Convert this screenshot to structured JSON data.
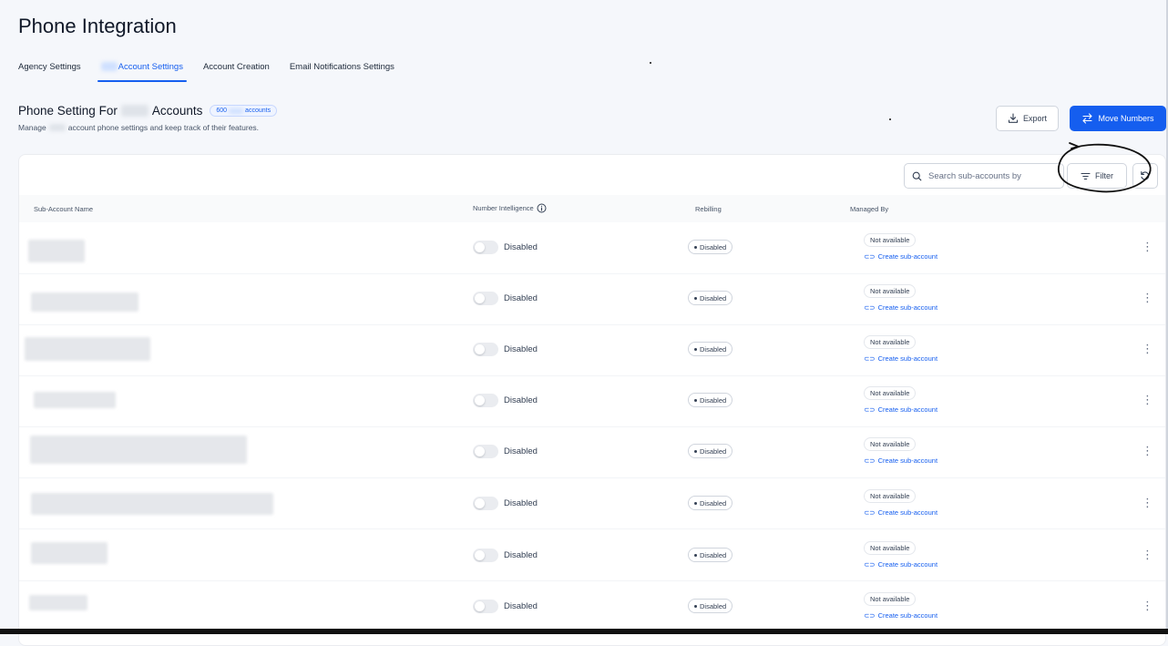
{
  "page_title": "Phone Integration",
  "tabs": [
    {
      "label": "Agency Settings",
      "active": false
    },
    {
      "label": "Account Settings",
      "active": true
    },
    {
      "label": "Account Creation",
      "active": false
    },
    {
      "label": "Email Notifications Settings",
      "active": false
    }
  ],
  "section": {
    "title_prefix": "Phone Setting For",
    "title_suffix": "Accounts",
    "count_number": "600",
    "count_word": "accounts",
    "subtitle_prefix": "Manage",
    "subtitle_suffix": "account phone settings and keep track of their features."
  },
  "actions": {
    "export_label": "Export",
    "move_numbers_label": "Move Numbers"
  },
  "toolbar": {
    "search_placeholder": "Search sub-accounts by",
    "filter_label": "Filter"
  },
  "table": {
    "headers": {
      "name": "Sub-Account Name",
      "number_intelligence": "Number Intelligence",
      "rebilling": "Rebilling",
      "managed_by": "Managed By"
    },
    "rows": [
      {
        "number_intelligence": "Disabled",
        "rebilling": "Disabled",
        "managed_by": "Not available",
        "link": "Create sub-account"
      },
      {
        "number_intelligence": "Disabled",
        "rebilling": "Disabled",
        "managed_by": "Not available",
        "link": "Create sub-account"
      },
      {
        "number_intelligence": "Disabled",
        "rebilling": "Disabled",
        "managed_by": "Not available",
        "link": "Create sub-account"
      },
      {
        "number_intelligence": "Disabled",
        "rebilling": "Disabled",
        "managed_by": "Not available",
        "link": "Create sub-account"
      },
      {
        "number_intelligence": "Disabled",
        "rebilling": "Disabled",
        "managed_by": "Not available",
        "link": "Create sub-account"
      },
      {
        "number_intelligence": "Disabled",
        "rebilling": "Disabled",
        "managed_by": "Not available",
        "link": "Create sub-account"
      },
      {
        "number_intelligence": "Disabled",
        "rebilling": "Disabled",
        "managed_by": "Not available",
        "link": "Create sub-account"
      },
      {
        "number_intelligence": "Disabled",
        "rebilling": "Disabled",
        "managed_by": "Not available",
        "link": "Create sub-account"
      }
    ]
  },
  "colors": {
    "accent": "#155eef",
    "background": "#f5f7fb",
    "text": "#101828"
  },
  "icons": [
    "download-icon",
    "swap-arrows-icon",
    "search-icon",
    "filter-lines-icon",
    "refresh-icon",
    "info-icon",
    "link-icon",
    "kebab-menu-icon"
  ]
}
